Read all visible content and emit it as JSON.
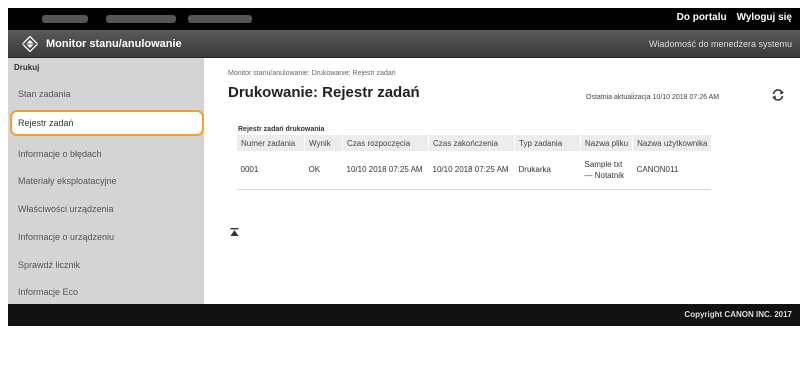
{
  "header": {
    "portal_link": "Do portalu",
    "logout_link": "Wyloguj się"
  },
  "titlebar": {
    "app_title": "Monitor stanu/anulowanie",
    "admin_message": "Wiadomość do menedżera systemu",
    "logo_icon": "canon-diamond-logo-icon"
  },
  "sidebar": {
    "group": "Drukuj",
    "items": [
      {
        "label": "Stan zadania"
      },
      {
        "label": "Rejestr zadań"
      },
      {
        "label": "Informacje o błędach"
      },
      {
        "label": "Materiały eksploatacyjne"
      },
      {
        "label": "Właściwości urządzenia"
      },
      {
        "label": "Informacje o urządzeniu"
      },
      {
        "label": "Sprawdź licznik"
      },
      {
        "label": "Informacje Eco"
      }
    ],
    "active_index": 1,
    "highlight_color": "#f0a030"
  },
  "main": {
    "breadcrumb": "Monitor stanu/anulowanie: Drukowanie: Rejestr zadań",
    "title": "Drukowanie: Rejestr zadań",
    "last_update": "Ostatnia aktualizacja 10/10 2018 07:26 AM",
    "refresh_icon": "refresh-icon",
    "section_title": "Rejestr zadań drukowania",
    "table": {
      "headers": [
        "Numer zadania",
        "Wynik",
        "Czas rozpoczęcia",
        "Czas zakończenia",
        "Typ zadania",
        "Nazwa pliku",
        "Nazwa użytkownika"
      ],
      "rows": [
        {
          "job_number": "0001",
          "result": "OK",
          "start_time": "10/10 2018 07:25 AM",
          "end_time": "10/10 2018 07:25 AM",
          "job_type": "Drukarka",
          "file_name": "Sample txt — Notatnik",
          "user_name": "CANON011"
        }
      ]
    },
    "collapse_icon": "collapse-to-top-icon"
  },
  "footer": {
    "copyright": "Copyright CANON INC. 2017"
  }
}
